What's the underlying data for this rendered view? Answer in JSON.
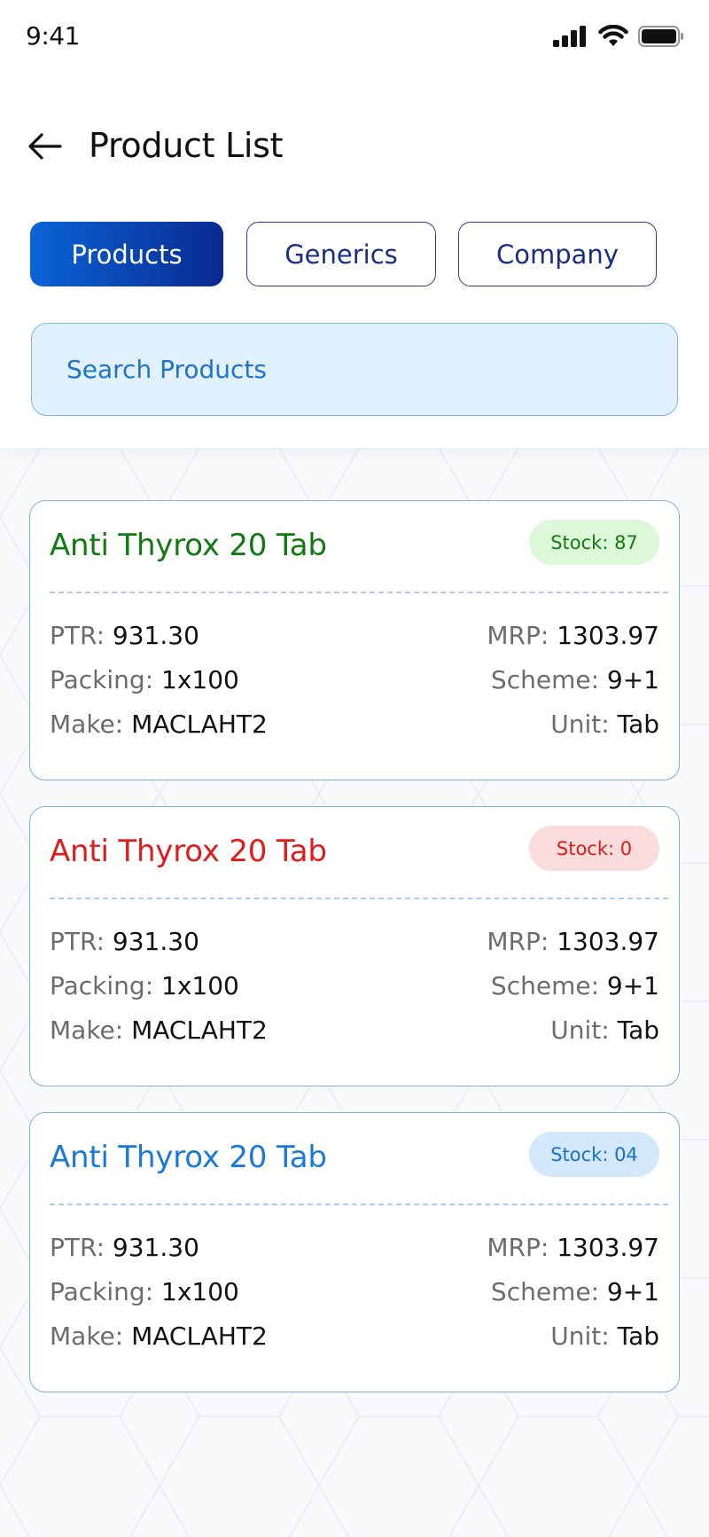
{
  "status_bar": {
    "time": "9:41",
    "icons": [
      "cellular-signal-icon",
      "wifi-icon",
      "battery-icon"
    ]
  },
  "header": {
    "title": "Product List",
    "back_icon": "arrow-left-icon"
  },
  "tabs": [
    {
      "label": "Products",
      "active": true
    },
    {
      "label": "Generics",
      "active": false
    },
    {
      "label": "Company",
      "active": false
    }
  ],
  "search": {
    "placeholder": "Search Products",
    "value": ""
  },
  "colors": {
    "tab_active_gradient": [
      "#0a64d8",
      "#0a2a8f"
    ],
    "search_bg": "#e1f0fd",
    "card_border": "#7fb0e0",
    "in_stock_green": "#0f7a0f",
    "out_of_stock_red": "#e01b1b",
    "low_stock_blue": "#1a78d6"
  },
  "products": [
    {
      "name": "Anti Thyrox 20 Tab",
      "stock_label": "Stock: 87",
      "status": "in-stock",
      "ptr_label": "PTR:",
      "ptr": "931.30",
      "mrp_label": "MRP:",
      "mrp": "1303.97",
      "packing_label": "Packing:",
      "packing": "1x100",
      "scheme_label": "Scheme:",
      "scheme": "9+1",
      "make_label": "Make:",
      "make": "MACLAHT2",
      "unit_label": "Unit:",
      "unit": "Tab"
    },
    {
      "name": "Anti Thyrox 20 Tab",
      "stock_label": "Stock: 0",
      "status": "out-of-stock",
      "ptr_label": "PTR:",
      "ptr": "931.30",
      "mrp_label": "MRP:",
      "mrp": "1303.97",
      "packing_label": "Packing:",
      "packing": "1x100",
      "scheme_label": "Scheme:",
      "scheme": "9+1",
      "make_label": "Make:",
      "make": "MACLAHT2",
      "unit_label": "Unit:",
      "unit": "Tab"
    },
    {
      "name": "Anti Thyrox 20 Tab",
      "stock_label": "Stock: 04",
      "status": "low-stock",
      "ptr_label": "PTR:",
      "ptr": "931.30",
      "mrp_label": "MRP:",
      "mrp": "1303.97",
      "packing_label": "Packing:",
      "packing": "1x100",
      "scheme_label": "Scheme:",
      "scheme": "9+1",
      "make_label": "Make:",
      "make": "MACLAHT2",
      "unit_label": "Unit:",
      "unit": "Tab"
    }
  ]
}
